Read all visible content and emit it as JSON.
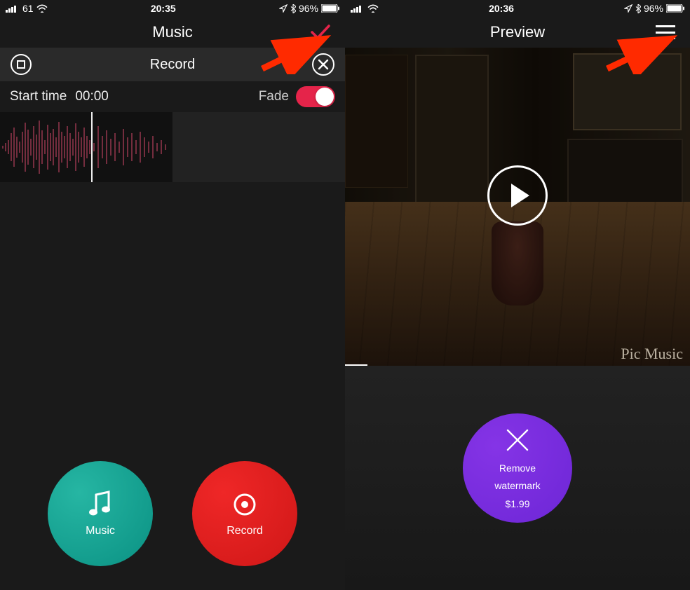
{
  "left": {
    "status": {
      "carrier": "61",
      "time": "20:35",
      "battery": "96%"
    },
    "nav": {
      "title": "Music"
    },
    "record_section": {
      "label": "Record"
    },
    "time_row": {
      "start_label": "Start time",
      "start_value": "00:00",
      "fade_label": "Fade",
      "fade_on": true
    },
    "buttons": {
      "music": "Music",
      "record": "Record"
    }
  },
  "right": {
    "status": {
      "carrier": "",
      "time": "20:36",
      "battery": "96%"
    },
    "nav": {
      "title": "Preview"
    },
    "watermark": "Pic Music",
    "remove_watermark": {
      "line1": "Remove",
      "line2": "watermark",
      "price": "$1.99"
    }
  },
  "colors": {
    "accent_pink": "#e5244a",
    "teal": "#17a294",
    "red": "#e02121",
    "purple": "#7a2de0"
  }
}
